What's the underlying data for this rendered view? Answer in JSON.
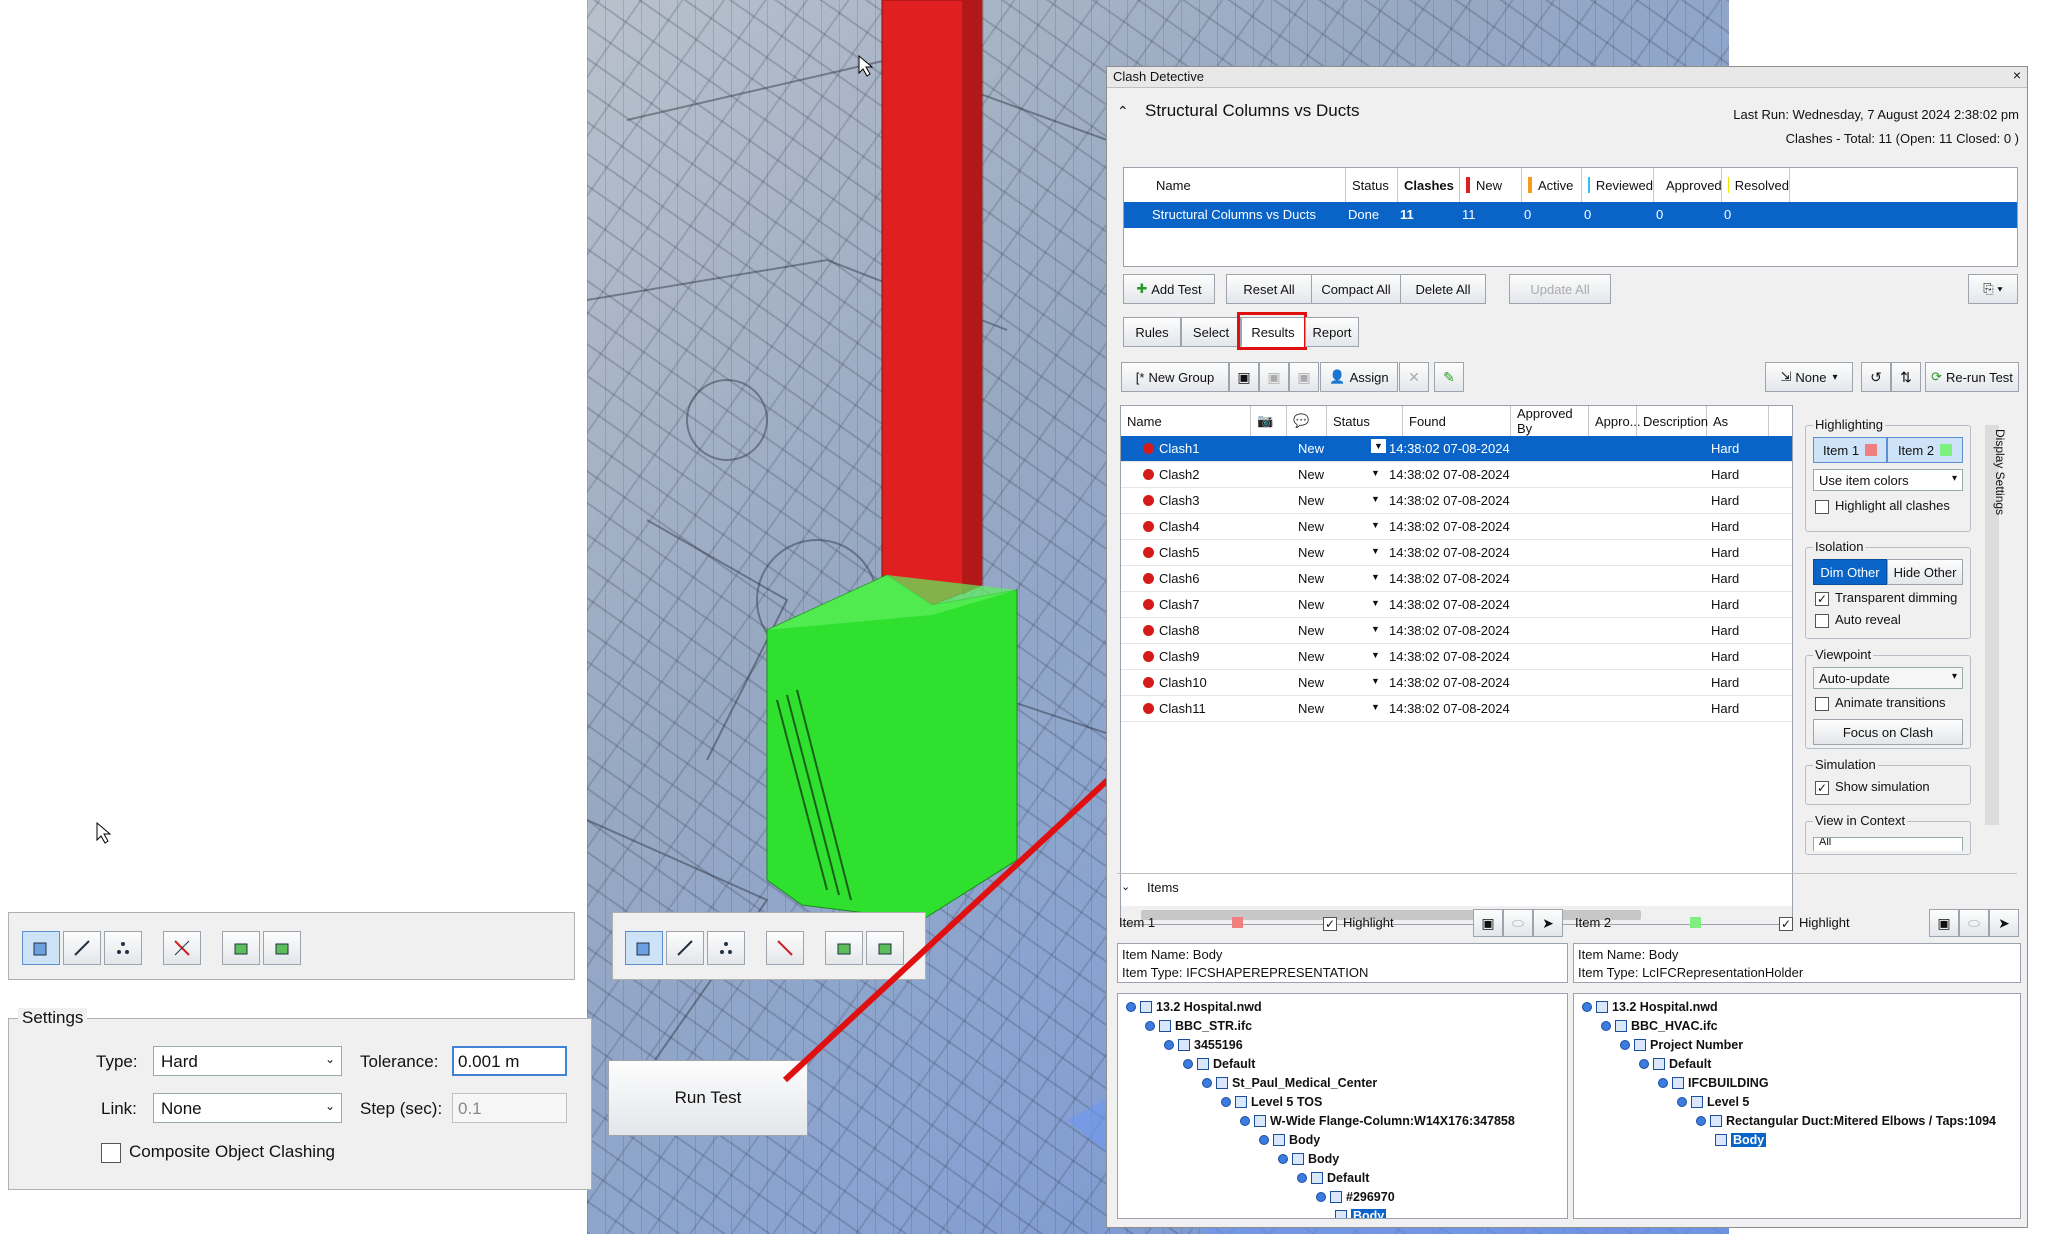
{
  "settings": {
    "title": "Settings",
    "type_label": "Type:",
    "type_value": "Hard",
    "tolerance_label": "Tolerance:",
    "tolerance_value": "0.001 m",
    "link_label": "Link:",
    "link_value": "None",
    "step_label": "Step (sec):",
    "step_value": "0.1",
    "composite_label": "Composite Object Clashing",
    "run_test_label": "Run Test"
  },
  "clash_detective": {
    "window_title": "Clash Detective",
    "close_glyph": "×",
    "test_name": "Structural Columns vs Ducts",
    "last_run": "Last Run:  Wednesday, 7 August 2024 2:38:02 pm",
    "clashes_summary": "Clashes - Total:  11  (Open:  11  Closed:  0 )",
    "tests_table": {
      "headers": [
        "Name",
        "Status",
        "Clashes",
        "New",
        "Active",
        "Reviewed",
        "Approved",
        "Resolved"
      ],
      "header_colors": [
        "",
        "",
        "",
        "#e02020",
        "#f59a1d",
        "#2ec3f0",
        "#2ecc40",
        "#f2e600"
      ],
      "row": [
        "Structural Columns vs Ducts",
        "Done",
        "11",
        "11",
        "0",
        "0",
        "0",
        "0"
      ]
    },
    "test_buttons": [
      "Add Test",
      "Reset All",
      "Compact All",
      "Delete All",
      "Update All"
    ],
    "tabs": [
      "Rules",
      "Select",
      "Results",
      "Report"
    ],
    "toolbar": {
      "new_group": "New Group",
      "assign": "Assign",
      "none": "None",
      "rerun": "Re-run Test"
    },
    "results_headers": [
      "Name",
      "Status",
      "Found",
      "Approved By",
      "Appro...",
      "Description",
      "As"
    ],
    "results": [
      {
        "name": "Clash1",
        "status": "New",
        "found": "14:38:02 07-08-2024",
        "description": "Hard"
      },
      {
        "name": "Clash2",
        "status": "New",
        "found": "14:38:02 07-08-2024",
        "description": "Hard"
      },
      {
        "name": "Clash3",
        "status": "New",
        "found": "14:38:02 07-08-2024",
        "description": "Hard"
      },
      {
        "name": "Clash4",
        "status": "New",
        "found": "14:38:02 07-08-2024",
        "description": "Hard"
      },
      {
        "name": "Clash5",
        "status": "New",
        "found": "14:38:02 07-08-2024",
        "description": "Hard"
      },
      {
        "name": "Clash6",
        "status": "New",
        "found": "14:38:02 07-08-2024",
        "description": "Hard"
      },
      {
        "name": "Clash7",
        "status": "New",
        "found": "14:38:02 07-08-2024",
        "description": "Hard"
      },
      {
        "name": "Clash8",
        "status": "New",
        "found": "14:38:02 07-08-2024",
        "description": "Hard"
      },
      {
        "name": "Clash9",
        "status": "New",
        "found": "14:38:02 07-08-2024",
        "description": "Hard"
      },
      {
        "name": "Clash10",
        "status": "New",
        "found": "14:38:02 07-08-2024",
        "description": "Hard"
      },
      {
        "name": "Clash11",
        "status": "New",
        "found": "14:38:02 07-08-2024",
        "description": "Hard"
      }
    ],
    "display_settings": {
      "side_tab": "Display Settings",
      "highlighting_title": "Highlighting",
      "item1": "Item 1",
      "item2": "Item 2",
      "item1_color": "#f08080",
      "item2_color": "#7ef07e",
      "color_mode": "Use item colors",
      "highlight_all": "Highlight all clashes",
      "isolation_title": "Isolation",
      "dim_other": "Dim Other",
      "hide_other": "Hide Other",
      "transparent_dimming": "Transparent dimming",
      "auto_reveal": "Auto reveal",
      "viewpoint_title": "Viewpoint",
      "viewpoint_mode": "Auto-update",
      "animate_transitions": "Animate transitions",
      "focus_on_clash": "Focus on Clash",
      "simulation_title": "Simulation",
      "show_simulation": "Show simulation",
      "view_in_context_title": "View in Context",
      "view_in_context_value": "All"
    },
    "items": {
      "title": "Items",
      "item1": {
        "label": "Item 1",
        "highlight": "Highlight",
        "item_name": "Item Name: Body",
        "item_type": "Item Type: IFCSHAPEREPRESENTATION",
        "tree": [
          "13.2 Hospital.nwd",
          "BBC_STR.ifc",
          "3455196",
          "Default",
          "St_Paul_Medical_Center",
          "Level 5 TOS",
          "W-Wide Flange-Column:W14X176:347858",
          "Body",
          "Body",
          "Default",
          "#296970",
          "Body"
        ]
      },
      "item2": {
        "label": "Item 2",
        "highlight": "Highlight",
        "item_name": "Item Name: Body",
        "item_type": "Item Type: LcIFCRepresentationHolder",
        "tree": [
          "13.2 Hospital.nwd",
          "BBC_HVAC.ifc",
          "Project Number",
          "Default",
          "IFCBUILDING",
          "Level 5",
          "Rectangular Duct:Mitered Elbows / Taps:1094",
          "Body"
        ]
      }
    }
  }
}
